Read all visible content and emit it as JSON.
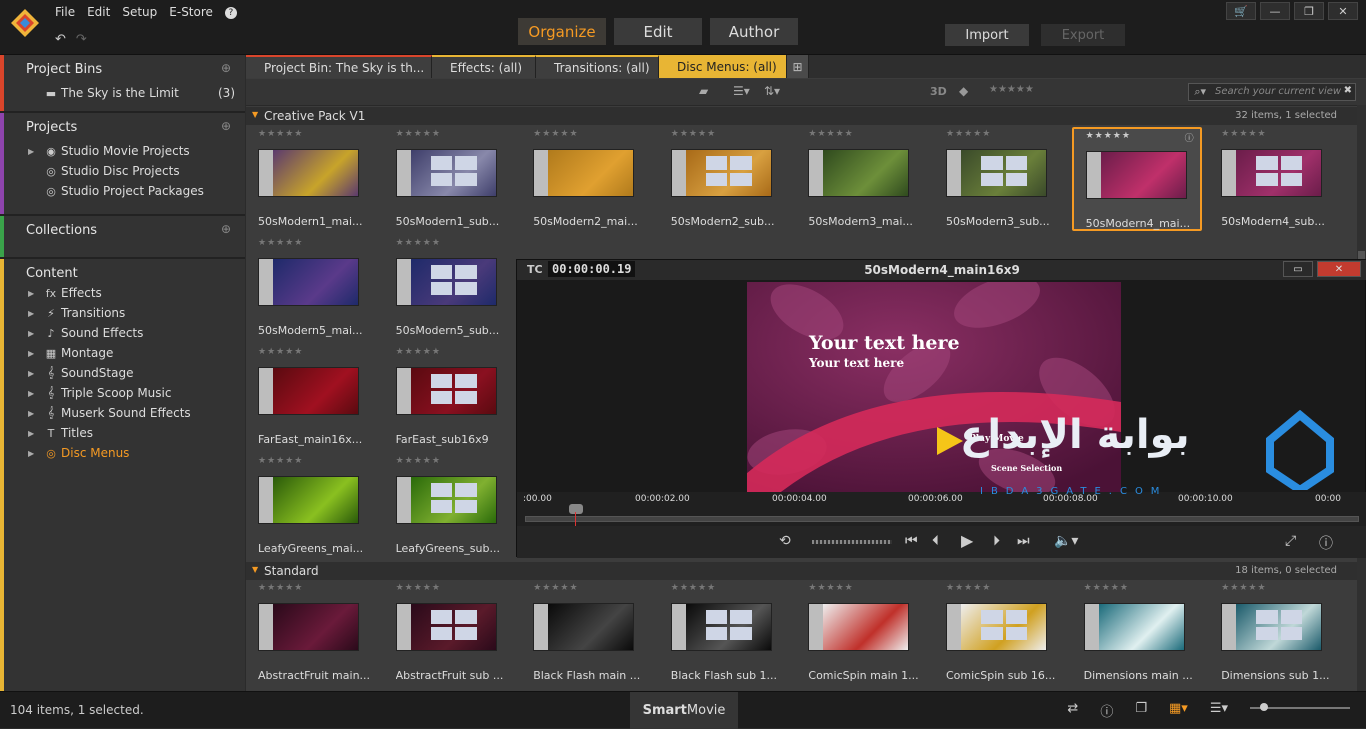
{
  "menu": [
    "File",
    "Edit",
    "Setup",
    "E-Store",
    "?"
  ],
  "modes": [
    "Organize",
    "Edit",
    "Author"
  ],
  "import_label": "Import",
  "export_label": "Export",
  "sidebar": {
    "project_bins": {
      "title": "Project Bins",
      "items": [
        {
          "label": "The Sky is the Limit",
          "count": "(3)"
        }
      ]
    },
    "projects": {
      "title": "Projects",
      "items": [
        {
          "label": "Studio Movie Projects"
        },
        {
          "label": "Studio Disc Projects"
        },
        {
          "label": "Studio Project Packages"
        }
      ]
    },
    "collections": {
      "title": "Collections"
    },
    "content": {
      "title": "Content",
      "items": [
        {
          "label": "Effects",
          "icon": "fx"
        },
        {
          "label": "Transitions",
          "icon": "⚡"
        },
        {
          "label": "Sound Effects",
          "icon": "♪"
        },
        {
          "label": "Montage",
          "icon": "▦"
        },
        {
          "label": "SoundStage",
          "icon": "𝄞"
        },
        {
          "label": "Triple Scoop Music",
          "icon": "𝄞"
        },
        {
          "label": "Muserk Sound Effects",
          "icon": "𝄞"
        },
        {
          "label": "Titles",
          "icon": "T"
        },
        {
          "label": "Disc Menus",
          "icon": "◎"
        }
      ]
    }
  },
  "tabs": [
    "Project Bin: The Sky is th...",
    "Effects: (all)",
    "Transitions: (all)",
    "Disc Menus: (all)"
  ],
  "toolbar": {
    "label_3d": "3D",
    "search_placeholder": "Search your current view"
  },
  "groups": [
    {
      "title": "Creative Pack V1",
      "count": "32 items, 1 selected"
    },
    {
      "title": "Standard",
      "count": "18 items, 0 selected"
    }
  ],
  "tiles_row1": [
    "50sModern1_mai...",
    "50sModern1_sub...",
    "50sModern2_mai...",
    "50sModern2_sub...",
    "50sModern3_mai...",
    "50sModern3_sub...",
    "50sModern4_mai...",
    "50sModern4_sub..."
  ],
  "tiles_left": [
    "50sModern5_mai...",
    "50sModern5_sub...",
    "FarEast_main16x...",
    "FarEast_sub16x9",
    "LeafyGreens_mai...",
    "LeafyGreens_sub..."
  ],
  "tiles_std": [
    "AbstractFruit main...",
    "AbstractFruit sub ...",
    "Black Flash main ...",
    "Black Flash sub 1...",
    "ComicSpin main 1...",
    "ComicSpin sub 16...",
    "Dimensions main ...",
    "Dimensions sub 1..."
  ],
  "preview": {
    "tc_label": "TC",
    "timecode": "00:00:00.19",
    "title": "50sModern4_main16x9",
    "text1": "Your text here",
    "text2": "Your text here",
    "play": "Play Movie",
    "scene": "Scene Selection",
    "ticks": [
      ":00.00",
      "00:00:02.00",
      "00:00:04.00",
      "00:00:06.00",
      "00:00:08.00",
      "00:00:10.00",
      "00:00"
    ]
  },
  "watermark": {
    "arabic": "بوابة الإبداع",
    "latin": "IBDA3GATE.COM"
  },
  "status": "104 items, 1 selected.",
  "smartmovie": {
    "bold": "Smart",
    "rest": "Movie"
  },
  "colors": {
    "accent": "#f59a23",
    "bins": "#d9452b",
    "projects": "#8e44ad",
    "collections": "#3aa34a",
    "content": "#e8b534"
  }
}
